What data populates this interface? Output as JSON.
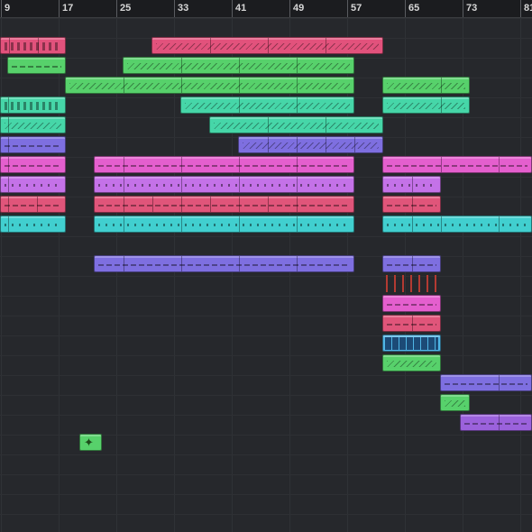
{
  "ruler": {
    "bars": [
      "9",
      "17",
      "25",
      "33",
      "41",
      "49",
      "57",
      "65",
      "73",
      "81"
    ]
  },
  "colors": {
    "red": "#e2527c",
    "green": "#57d16b",
    "teal": "#46d6a8",
    "violet": "#7e6fe0",
    "pink": "#e45fce",
    "lilac": "#c472e8",
    "rose": "#e0557a",
    "cyan": "#41cfcf",
    "blue_clip": "#4fb6e6",
    "purple": "#9b62dc"
  },
  "tracks": [
    {
      "color": "red",
      "clips": [
        {
          "pattern": "steps"
        },
        {
          "pattern": "wave"
        }
      ]
    },
    {
      "color": "green",
      "clips": [
        {
          "pattern": "dash"
        },
        {
          "pattern": "wave"
        }
      ]
    },
    {
      "color": "green",
      "clips": [
        {
          "pattern": "wave"
        },
        {
          "pattern": "wave"
        }
      ]
    },
    {
      "color": "teal",
      "clips": [
        {
          "pattern": "steps"
        },
        {
          "pattern": "wave"
        },
        {
          "pattern": "wave"
        }
      ]
    },
    {
      "color": "teal",
      "clips": [
        {
          "pattern": "wave"
        },
        {
          "pattern": "wave"
        }
      ]
    },
    {
      "color": "violet",
      "clips": [
        {
          "pattern": "dash"
        },
        {
          "pattern": "wave"
        }
      ]
    },
    {
      "color": "pink",
      "clips": [
        {
          "pattern": "dash"
        },
        {
          "pattern": "dash"
        },
        {
          "pattern": "dash"
        }
      ]
    },
    {
      "color": "lilac",
      "clips": [
        {
          "pattern": "dots"
        },
        {
          "pattern": "dots"
        },
        {
          "pattern": "dots"
        }
      ]
    },
    {
      "color": "rose",
      "clips": [
        {
          "pattern": "dash"
        },
        {
          "pattern": "dash"
        },
        {
          "pattern": "dash"
        }
      ]
    },
    {
      "color": "cyan",
      "clips": [
        {
          "pattern": "dots"
        },
        {
          "pattern": "dots"
        },
        {
          "pattern": "dots"
        }
      ]
    },
    {
      "color": "none",
      "clips": []
    },
    {
      "color": "violet",
      "clips": [
        {
          "pattern": "dash"
        },
        {
          "pattern": "dash"
        }
      ]
    },
    {
      "color": "red",
      "clips": [
        {
          "pattern": "spikes"
        }
      ]
    },
    {
      "color": "pink",
      "clips": [
        {
          "pattern": "dash"
        }
      ]
    },
    {
      "color": "rose",
      "clips": [
        {
          "pattern": "dash"
        }
      ]
    },
    {
      "color": "blue_clip",
      "clips": [
        {
          "pattern": "arrows"
        }
      ]
    },
    {
      "color": "green",
      "clips": [
        {
          "pattern": "wave"
        }
      ]
    },
    {
      "color": "violet",
      "clips": [
        {
          "pattern": "dash"
        }
      ]
    },
    {
      "color": "green",
      "clips": [
        {
          "pattern": "wave"
        }
      ]
    },
    {
      "color": "purple",
      "clips": [
        {
          "pattern": "dash"
        }
      ]
    },
    {
      "color": "green",
      "clips": [
        {
          "pattern": "icon"
        }
      ]
    }
  ]
}
